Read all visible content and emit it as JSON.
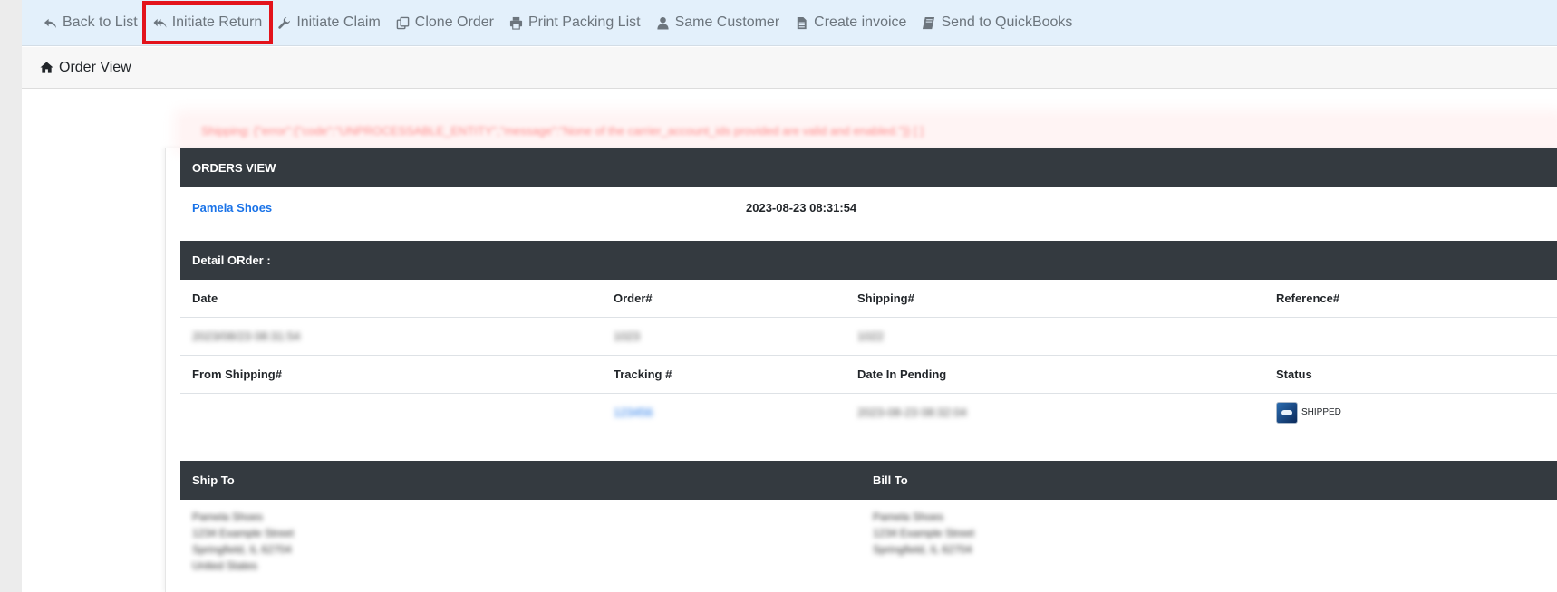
{
  "toolbar": {
    "items": [
      {
        "label": "Back to List",
        "icon": "back-arrow-icon"
      },
      {
        "label": "Initiate Return",
        "icon": "reply-icon",
        "highlighted": true
      },
      {
        "label": "Initiate Claim",
        "icon": "wrench-icon"
      },
      {
        "label": "Clone Order",
        "icon": "copy-icon"
      },
      {
        "label": "Print Packing List",
        "icon": "print-icon"
      },
      {
        "label": "Same Customer",
        "icon": "user-icon"
      },
      {
        "label": "Create invoice",
        "icon": "file-icon"
      },
      {
        "label": "Send to QuickBooks",
        "icon": "book-icon"
      }
    ],
    "highlight_color": "#e3131b"
  },
  "breadcrumb": {
    "label": "Order View",
    "icon": "home-icon"
  },
  "error_message": "Shipping: {\"error\":{\"code\":\"UNPROCESSABLE_ENTITY\",\"message\":\"None of the carrier_account_ids provided are valid and enabled.\"}} [ ]",
  "orders_view": {
    "header": "ORDERS VIEW",
    "customer": "Pamela Shoes",
    "datetime": "2023-08-23 08:31:54"
  },
  "detail": {
    "header": "Detail ORder :",
    "row1_labels": {
      "date": "Date",
      "order": "Order#",
      "shipping": "Shipping#",
      "reference": "Reference#"
    },
    "row1_values": {
      "date": "2023/08/23 08:31:54",
      "order": "1023",
      "shipping": "1022",
      "reference": ""
    },
    "row2_labels": {
      "from_shipping": "From Shipping#",
      "tracking": "Tracking #",
      "date_pending": "Date In Pending",
      "status": "Status"
    },
    "row2_values": {
      "from_shipping": "",
      "tracking": "123456",
      "date_pending": "2023-08-23 08:32:04",
      "status": "SHIPPED"
    }
  },
  "addresses": {
    "ship_to_label": "Ship To",
    "bill_to_label": "Bill To",
    "ship_to_lines": [
      "Pamela Shoes",
      "1234 Example Street",
      "Springfield, IL 62704",
      "United States"
    ],
    "bill_to_lines": [
      "Pamela Shoes",
      "1234 Example Street",
      "Springfield, IL 62704"
    ]
  },
  "colors": {
    "toolbar_bg": "#e3f0fb",
    "dark_header": "#343a40",
    "link": "#1a73e8",
    "muted": "#6c757d"
  }
}
